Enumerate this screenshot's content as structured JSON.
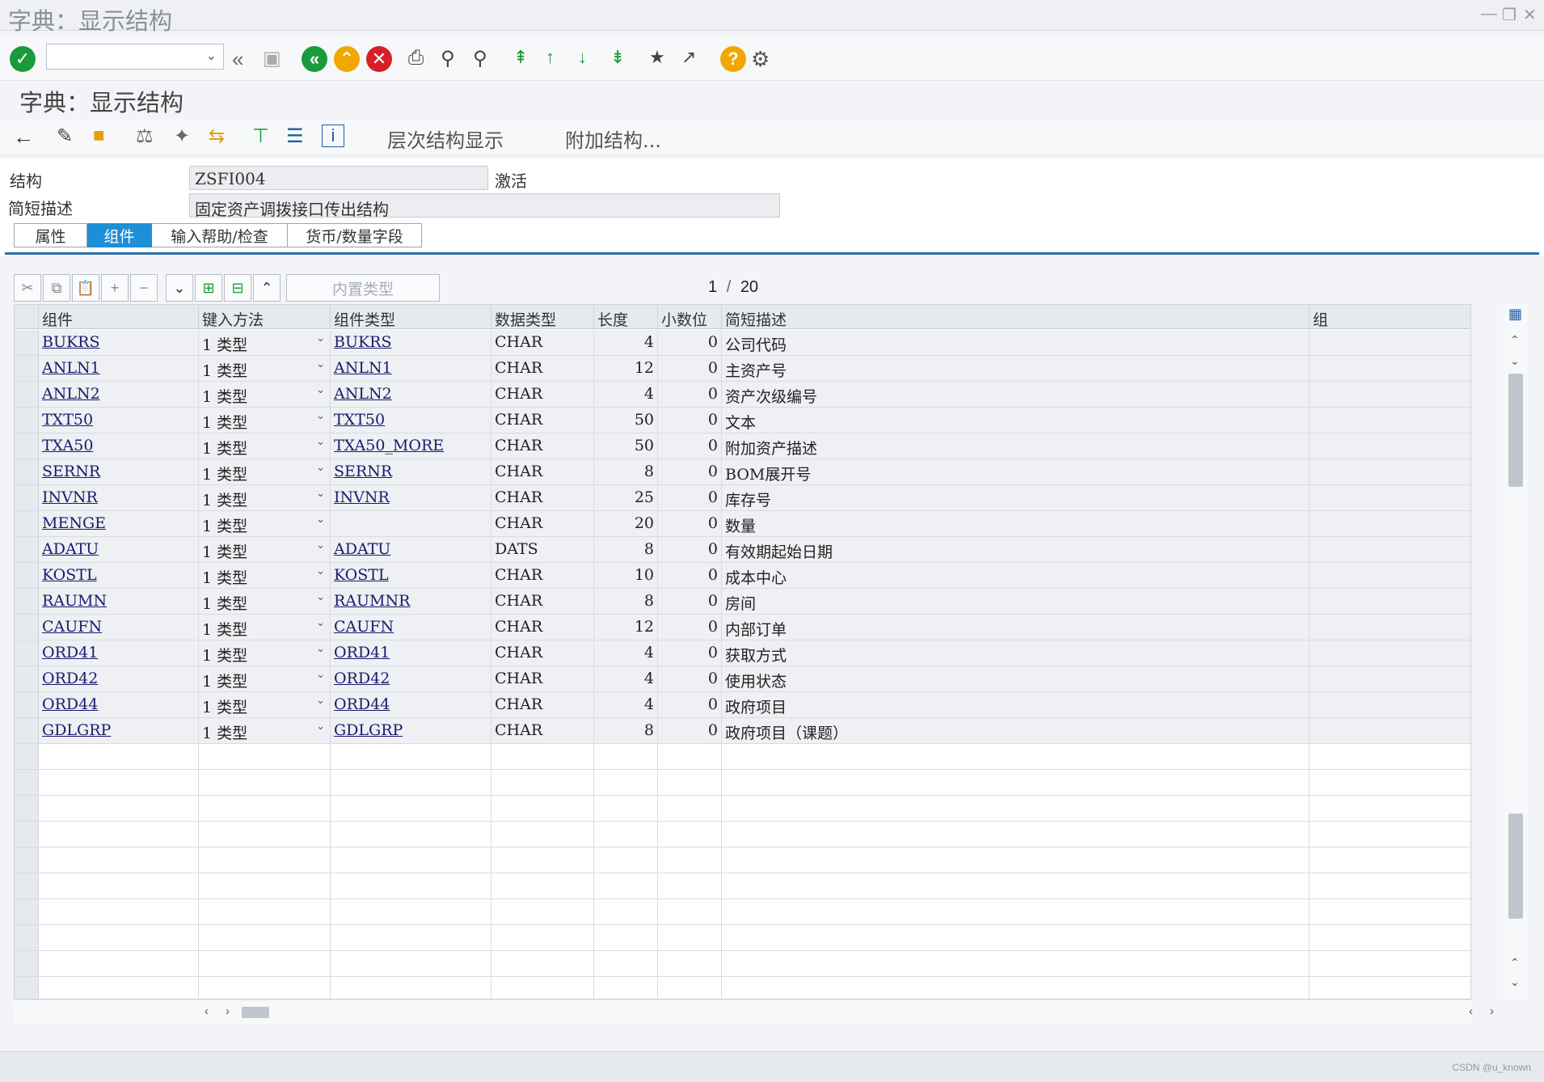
{
  "window": {
    "title": "字典：显示结构"
  },
  "page_title": "字典：显示结构",
  "toolbar2": {
    "hierarchy_label": "层次结构显示",
    "append_label": "附加结构..."
  },
  "form": {
    "structure_label": "结构",
    "structure_value": "ZSFI004",
    "status": "激活",
    "desc_label": "简短描述",
    "desc_value": "固定资产调拨接口传出结构"
  },
  "tabs": [
    {
      "label": "属性",
      "active": false
    },
    {
      "label": "组件",
      "active": true
    },
    {
      "label": "输入帮助/检查",
      "active": false
    },
    {
      "label": "货币/数量字段",
      "active": false
    }
  ],
  "grid_toolbar": {
    "search_placeholder": "内置类型"
  },
  "pager": {
    "current": "1",
    "sep": "/",
    "total": "20"
  },
  "columns": [
    "组件",
    "键入方法",
    "组件类型",
    "数据类型",
    "长度",
    "小数位",
    "简短描述",
    "组"
  ],
  "rows": [
    {
      "component": "BUKRS",
      "entry": "1 类型",
      "ctype": "BUKRS",
      "dtype": "CHAR",
      "len": "4",
      "dec": "0",
      "desc": "公司代码"
    },
    {
      "component": "ANLN1",
      "entry": "1 类型",
      "ctype": "ANLN1",
      "dtype": "CHAR",
      "len": "12",
      "dec": "0",
      "desc": "主资产号"
    },
    {
      "component": "ANLN2",
      "entry": "1 类型",
      "ctype": "ANLN2",
      "dtype": "CHAR",
      "len": "4",
      "dec": "0",
      "desc": "资产次级编号"
    },
    {
      "component": "TXT50",
      "entry": "1 类型",
      "ctype": "TXT50",
      "dtype": "CHAR",
      "len": "50",
      "dec": "0",
      "desc": "文本"
    },
    {
      "component": "TXA50",
      "entry": "1 类型",
      "ctype": "TXA50_MORE",
      "dtype": "CHAR",
      "len": "50",
      "dec": "0",
      "desc": "附加资产描述"
    },
    {
      "component": "SERNR",
      "entry": "1 类型",
      "ctype": "SERNR",
      "dtype": "CHAR",
      "len": "8",
      "dec": "0",
      "desc": "BOM展开号"
    },
    {
      "component": "INVNR",
      "entry": "1 类型",
      "ctype": "INVNR",
      "dtype": "CHAR",
      "len": "25",
      "dec": "0",
      "desc": "库存号"
    },
    {
      "component": "MENGE",
      "entry": "1 类型",
      "ctype": "",
      "dtype": "CHAR",
      "len": "20",
      "dec": "0",
      "desc": "数量"
    },
    {
      "component": "ADATU",
      "entry": "1 类型",
      "ctype": "ADATU",
      "dtype": "DATS",
      "len": "8",
      "dec": "0",
      "desc": "有效期起始日期"
    },
    {
      "component": "KOSTL",
      "entry": "1 类型",
      "ctype": "KOSTL",
      "dtype": "CHAR",
      "len": "10",
      "dec": "0",
      "desc": "成本中心"
    },
    {
      "component": "RAUMN",
      "entry": "1 类型",
      "ctype": "RAUMNR",
      "dtype": "CHAR",
      "len": "8",
      "dec": "0",
      "desc": "房间"
    },
    {
      "component": "CAUFN",
      "entry": "1 类型",
      "ctype": "CAUFN",
      "dtype": "CHAR",
      "len": "12",
      "dec": "0",
      "desc": "内部订单"
    },
    {
      "component": "ORD41",
      "entry": "1 类型",
      "ctype": "ORD41",
      "dtype": "CHAR",
      "len": "4",
      "dec": "0",
      "desc": "获取方式"
    },
    {
      "component": "ORD42",
      "entry": "1 类型",
      "ctype": "ORD42",
      "dtype": "CHAR",
      "len": "4",
      "dec": "0",
      "desc": "使用状态"
    },
    {
      "component": "ORD44",
      "entry": "1 类型",
      "ctype": "ORD44",
      "dtype": "CHAR",
      "len": "4",
      "dec": "0",
      "desc": "政府项目"
    },
    {
      "component": "GDLGRP",
      "entry": "1 类型",
      "ctype": "GDLGRP",
      "dtype": "CHAR",
      "len": "8",
      "dec": "0",
      "desc": "政府项目（课题）"
    }
  ]
}
